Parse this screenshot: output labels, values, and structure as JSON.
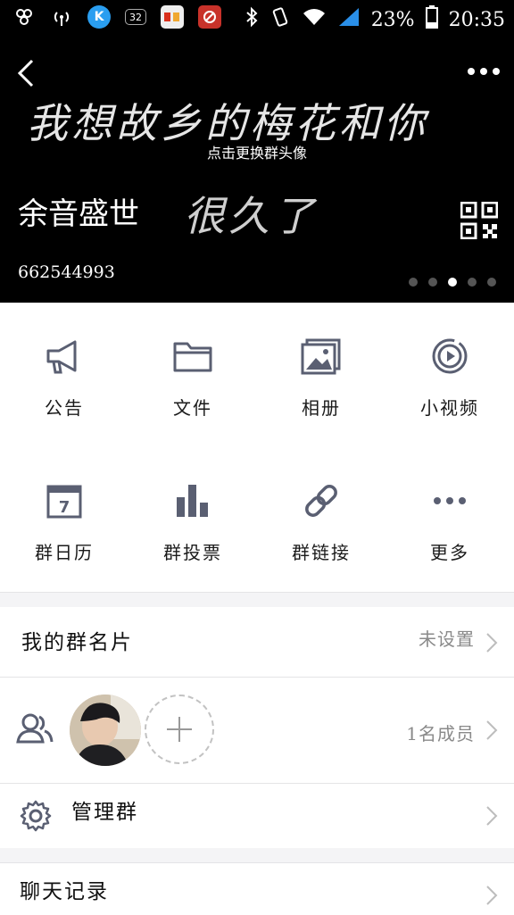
{
  "status_bar": {
    "app_icons": [
      "settings-icon",
      "wifi-hotspot-icon",
      "k-app-icon",
      "sim-32-icon",
      "news-app-icon",
      "location-app-icon"
    ],
    "sim_badge": "32",
    "battery": "23%",
    "time": "20:35"
  },
  "header": {
    "banner_text": "我想故乡的梅花和你",
    "tap_hint": "点击更换群头像",
    "group_name": "余音盛世",
    "sub_text": "很久了",
    "group_id": "662544993",
    "page_count": 5,
    "active_page": 3
  },
  "apps": [
    {
      "label": "公告",
      "icon": "megaphone-icon"
    },
    {
      "label": "文件",
      "icon": "folder-icon"
    },
    {
      "label": "相册",
      "icon": "album-icon"
    },
    {
      "label": "小视频",
      "icon": "video-icon"
    },
    {
      "label": "群日历",
      "icon": "calendar-icon"
    },
    {
      "label": "群投票",
      "icon": "vote-chart-icon"
    },
    {
      "label": "群链接",
      "icon": "link-icon"
    },
    {
      "label": "更多",
      "icon": "more-icon"
    }
  ],
  "rows": {
    "card_title": "我的群名片",
    "card_value": "未设置",
    "members_value": "1名成员",
    "manage_title": "管理群",
    "chat_title": "聊天记录"
  },
  "colors": {
    "icon": "#5a5f72",
    "header_bg": "#000000",
    "chevron": "#bdbdbd"
  }
}
